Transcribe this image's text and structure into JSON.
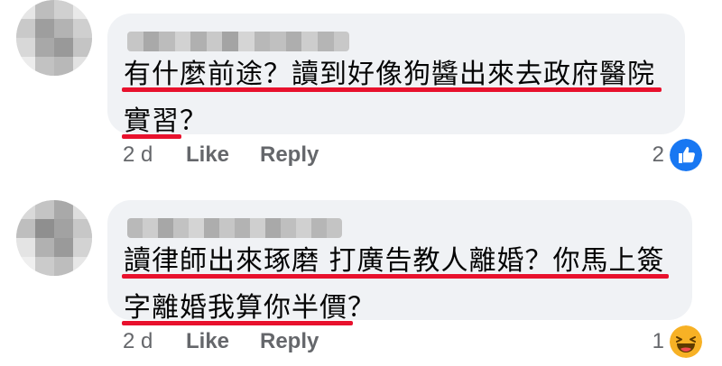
{
  "comments": [
    {
      "lines": [
        "有什麼前途？讀到好像狗醬出來去政府醫院",
        "實習？"
      ],
      "time": "2 d",
      "like_label": "Like",
      "reply_label": "Reply",
      "reaction_count": "2",
      "reaction_icon": "like-icon",
      "reaction_color": "#1877f2"
    },
    {
      "lines": [
        "讀律師出來琢磨 打廣告教人離婚？你馬上簽",
        "字離婚我算你半價？"
      ],
      "time": "2 d",
      "like_label": "Like",
      "reply_label": "Reply",
      "reaction_count": "1",
      "reaction_icon": "haha-icon",
      "reaction_color": "#f7b125"
    }
  ],
  "annotation_color": "#e8112d"
}
